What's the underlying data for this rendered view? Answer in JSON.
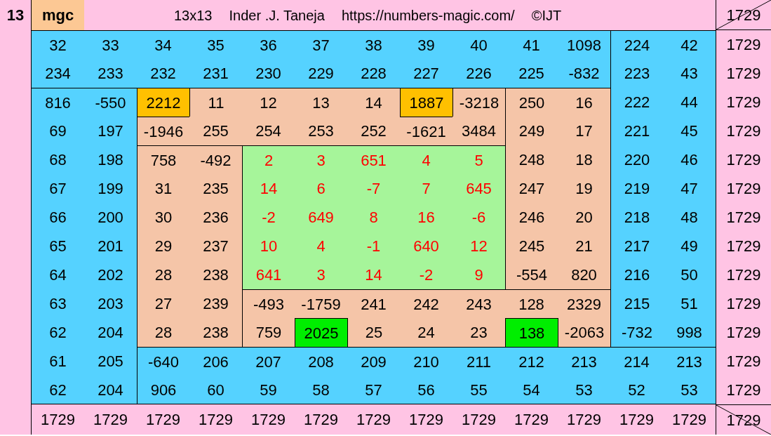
{
  "header": {
    "corner": "13",
    "tag": "mgc",
    "title_parts": [
      "13x13",
      "Inder .J. Taneja",
      "https://numbers-magic.com/",
      "©IJT"
    ],
    "total": "1729"
  },
  "rows": [
    {
      "total": "1729",
      "cells": [
        {
          "text": "32",
          "color": "#55d2ff",
          "red": false,
          "kind": "band_top"
        },
        {
          "text": "33",
          "color": "#55d2ff",
          "red": false,
          "kind": "band_top"
        },
        {
          "text": "34",
          "color": "#55d2ff",
          "red": false,
          "kind": "band_top"
        },
        {
          "text": "35",
          "color": "#55d2ff",
          "red": false,
          "kind": "band_top"
        },
        {
          "text": "36",
          "color": "#55d2ff",
          "red": false,
          "kind": "band_top"
        },
        {
          "text": "37",
          "color": "#55d2ff",
          "red": false,
          "kind": "band_top"
        },
        {
          "text": "38",
          "color": "#55d2ff",
          "red": false,
          "kind": "band_top"
        },
        {
          "text": "39",
          "color": "#55d2ff",
          "red": false,
          "kind": "band_top"
        },
        {
          "text": "40",
          "color": "#55d2ff",
          "red": false,
          "kind": "band_top"
        },
        {
          "text": "41",
          "color": "#55d2ff",
          "red": false,
          "kind": "band_top"
        },
        {
          "text": "1098",
          "color": "#55d2ff",
          "red": false,
          "kind": "band_top"
        },
        {
          "text": "224",
          "color": "#55d2ff",
          "red": false,
          "kind": "band_right"
        },
        {
          "text": "42",
          "color": "#55d2ff",
          "red": false,
          "kind": "band_right"
        }
      ]
    },
    {
      "total": "1729",
      "cells": [
        {
          "text": "234",
          "color": "#55d2ff",
          "red": false,
          "kind": "band_top"
        },
        {
          "text": "233",
          "color": "#55d2ff",
          "red": false,
          "kind": "band_top"
        },
        {
          "text": "232",
          "color": "#55d2ff",
          "red": false,
          "kind": "band_top"
        },
        {
          "text": "231",
          "color": "#55d2ff",
          "red": false,
          "kind": "band_top"
        },
        {
          "text": "230",
          "color": "#55d2ff",
          "red": false,
          "kind": "band_top"
        },
        {
          "text": "229",
          "color": "#55d2ff",
          "red": false,
          "kind": "band_top"
        },
        {
          "text": "228",
          "color": "#55d2ff",
          "red": false,
          "kind": "band_top"
        },
        {
          "text": "227",
          "color": "#55d2ff",
          "red": false,
          "kind": "band_top"
        },
        {
          "text": "226",
          "color": "#55d2ff",
          "red": false,
          "kind": "band_top"
        },
        {
          "text": "225",
          "color": "#55d2ff",
          "red": false,
          "kind": "band_top"
        },
        {
          "text": "-832",
          "color": "#55d2ff",
          "red": false,
          "kind": "band_top"
        },
        {
          "text": "223",
          "color": "#55d2ff",
          "red": false,
          "kind": "band_right"
        },
        {
          "text": "43",
          "color": "#55d2ff",
          "red": false,
          "kind": "band_right"
        }
      ]
    },
    {
      "total": "1729",
      "cells": [
        {
          "text": "816",
          "color": "#55d2ff",
          "red": false,
          "kind": "band_left"
        },
        {
          "text": "-550",
          "color": "#55d2ff",
          "red": false,
          "kind": "band_left"
        },
        {
          "text": "2212",
          "color": "#ffc000",
          "red": false,
          "kind": "mark"
        },
        {
          "text": "11",
          "color": "#f5c5a8",
          "red": false,
          "kind": "frame_top"
        },
        {
          "text": "12",
          "color": "#f5c5a8",
          "red": false,
          "kind": "frame_top"
        },
        {
          "text": "13",
          "color": "#f5c5a8",
          "red": false,
          "kind": "frame_top"
        },
        {
          "text": "14",
          "color": "#f5c5a8",
          "red": false,
          "kind": "frame_top"
        },
        {
          "text": "1887",
          "color": "#ffc000",
          "red": false,
          "kind": "mark"
        },
        {
          "text": "-3218",
          "color": "#f5c5a8",
          "red": false,
          "kind": "frame_top"
        },
        {
          "text": "250",
          "color": "#f5c5a8",
          "red": false,
          "kind": "frame_right"
        },
        {
          "text": "16",
          "color": "#f5c5a8",
          "red": false,
          "kind": "frame_right"
        },
        {
          "text": "222",
          "color": "#55d2ff",
          "red": false,
          "kind": "band_right"
        },
        {
          "text": "44",
          "color": "#55d2ff",
          "red": false,
          "kind": "band_right"
        }
      ]
    },
    {
      "total": "1729",
      "cells": [
        {
          "text": "69",
          "color": "#55d2ff",
          "red": false,
          "kind": "band_left"
        },
        {
          "text": "197",
          "color": "#55d2ff",
          "red": false,
          "kind": "band_left"
        },
        {
          "text": "-1946",
          "color": "#f5c5a8",
          "red": false,
          "kind": "frame_top"
        },
        {
          "text": "255",
          "color": "#f5c5a8",
          "red": false,
          "kind": "frame_top"
        },
        {
          "text": "254",
          "color": "#f5c5a8",
          "red": false,
          "kind": "frame_top"
        },
        {
          "text": "253",
          "color": "#f5c5a8",
          "red": false,
          "kind": "frame_top"
        },
        {
          "text": "252",
          "color": "#f5c5a8",
          "red": false,
          "kind": "frame_top"
        },
        {
          "text": "-1621",
          "color": "#f5c5a8",
          "red": false,
          "kind": "frame_top"
        },
        {
          "text": "3484",
          "color": "#f5c5a8",
          "red": false,
          "kind": "frame_top"
        },
        {
          "text": "249",
          "color": "#f5c5a8",
          "red": false,
          "kind": "frame_right"
        },
        {
          "text": "17",
          "color": "#f5c5a8",
          "red": false,
          "kind": "frame_right"
        },
        {
          "text": "221",
          "color": "#55d2ff",
          "red": false,
          "kind": "band_right"
        },
        {
          "text": "45",
          "color": "#55d2ff",
          "red": false,
          "kind": "band_right"
        }
      ]
    },
    {
      "total": "1729",
      "cells": [
        {
          "text": "68",
          "color": "#55d2ff",
          "red": false,
          "kind": "band_left"
        },
        {
          "text": "198",
          "color": "#55d2ff",
          "red": false,
          "kind": "band_left"
        },
        {
          "text": "758",
          "color": "#f5c5a8",
          "red": false,
          "kind": "frame_left"
        },
        {
          "text": "-492",
          "color": "#f5c5a8",
          "red": false,
          "kind": "frame_left"
        },
        {
          "text": "2",
          "color": "#a6f59a",
          "red": true,
          "kind": "core"
        },
        {
          "text": "3",
          "color": "#a6f59a",
          "red": true,
          "kind": "core"
        },
        {
          "text": "651",
          "color": "#a6f59a",
          "red": true,
          "kind": "core"
        },
        {
          "text": "4",
          "color": "#a6f59a",
          "red": true,
          "kind": "core"
        },
        {
          "text": "5",
          "color": "#a6f59a",
          "red": true,
          "kind": "core"
        },
        {
          "text": "248",
          "color": "#f5c5a8",
          "red": false,
          "kind": "frame_right"
        },
        {
          "text": "18",
          "color": "#f5c5a8",
          "red": false,
          "kind": "frame_right"
        },
        {
          "text": "220",
          "color": "#55d2ff",
          "red": false,
          "kind": "band_right"
        },
        {
          "text": "46",
          "color": "#55d2ff",
          "red": false,
          "kind": "band_right"
        }
      ]
    },
    {
      "total": "1729",
      "cells": [
        {
          "text": "67",
          "color": "#55d2ff",
          "red": false,
          "kind": "band_left"
        },
        {
          "text": "199",
          "color": "#55d2ff",
          "red": false,
          "kind": "band_left"
        },
        {
          "text": "31",
          "color": "#f5c5a8",
          "red": false,
          "kind": "frame_left"
        },
        {
          "text": "235",
          "color": "#f5c5a8",
          "red": false,
          "kind": "frame_left"
        },
        {
          "text": "14",
          "color": "#a6f59a",
          "red": true,
          "kind": "core"
        },
        {
          "text": "6",
          "color": "#a6f59a",
          "red": true,
          "kind": "core"
        },
        {
          "text": "-7",
          "color": "#a6f59a",
          "red": true,
          "kind": "core"
        },
        {
          "text": "7",
          "color": "#a6f59a",
          "red": true,
          "kind": "core"
        },
        {
          "text": "645",
          "color": "#a6f59a",
          "red": true,
          "kind": "core"
        },
        {
          "text": "247",
          "color": "#f5c5a8",
          "red": false,
          "kind": "frame_right"
        },
        {
          "text": "19",
          "color": "#f5c5a8",
          "red": false,
          "kind": "frame_right"
        },
        {
          "text": "219",
          "color": "#55d2ff",
          "red": false,
          "kind": "band_right"
        },
        {
          "text": "47",
          "color": "#55d2ff",
          "red": false,
          "kind": "band_right"
        }
      ]
    },
    {
      "total": "1729",
      "cells": [
        {
          "text": "66",
          "color": "#55d2ff",
          "red": false,
          "kind": "band_left"
        },
        {
          "text": "200",
          "color": "#55d2ff",
          "red": false,
          "kind": "band_left"
        },
        {
          "text": "30",
          "color": "#f5c5a8",
          "red": false,
          "kind": "frame_left"
        },
        {
          "text": "236",
          "color": "#f5c5a8",
          "red": false,
          "kind": "frame_left"
        },
        {
          "text": "-2",
          "color": "#a6f59a",
          "red": true,
          "kind": "core"
        },
        {
          "text": "649",
          "color": "#a6f59a",
          "red": true,
          "kind": "core"
        },
        {
          "text": "8",
          "color": "#a6f59a",
          "red": true,
          "kind": "core"
        },
        {
          "text": "16",
          "color": "#a6f59a",
          "red": true,
          "kind": "core"
        },
        {
          "text": "-6",
          "color": "#a6f59a",
          "red": true,
          "kind": "core"
        },
        {
          "text": "246",
          "color": "#f5c5a8",
          "red": false,
          "kind": "frame_right"
        },
        {
          "text": "20",
          "color": "#f5c5a8",
          "red": false,
          "kind": "frame_right"
        },
        {
          "text": "218",
          "color": "#55d2ff",
          "red": false,
          "kind": "band_right"
        },
        {
          "text": "48",
          "color": "#55d2ff",
          "red": false,
          "kind": "band_right"
        }
      ]
    },
    {
      "total": "1729",
      "cells": [
        {
          "text": "65",
          "color": "#55d2ff",
          "red": false,
          "kind": "band_left"
        },
        {
          "text": "201",
          "color": "#55d2ff",
          "red": false,
          "kind": "band_left"
        },
        {
          "text": "29",
          "color": "#f5c5a8",
          "red": false,
          "kind": "frame_left"
        },
        {
          "text": "237",
          "color": "#f5c5a8",
          "red": false,
          "kind": "frame_left"
        },
        {
          "text": "10",
          "color": "#a6f59a",
          "red": true,
          "kind": "core"
        },
        {
          "text": "4",
          "color": "#a6f59a",
          "red": true,
          "kind": "core"
        },
        {
          "text": "-1",
          "color": "#a6f59a",
          "red": true,
          "kind": "core"
        },
        {
          "text": "640",
          "color": "#a6f59a",
          "red": true,
          "kind": "core"
        },
        {
          "text": "12",
          "color": "#a6f59a",
          "red": true,
          "kind": "core"
        },
        {
          "text": "245",
          "color": "#f5c5a8",
          "red": false,
          "kind": "frame_right"
        },
        {
          "text": "21",
          "color": "#f5c5a8",
          "red": false,
          "kind": "frame_right"
        },
        {
          "text": "217",
          "color": "#55d2ff",
          "red": false,
          "kind": "band_right"
        },
        {
          "text": "49",
          "color": "#55d2ff",
          "red": false,
          "kind": "band_right"
        }
      ]
    },
    {
      "total": "1729",
      "cells": [
        {
          "text": "64",
          "color": "#55d2ff",
          "red": false,
          "kind": "band_left"
        },
        {
          "text": "202",
          "color": "#55d2ff",
          "red": false,
          "kind": "band_left"
        },
        {
          "text": "28",
          "color": "#f5c5a8",
          "red": false,
          "kind": "frame_left"
        },
        {
          "text": "238",
          "color": "#f5c5a8",
          "red": false,
          "kind": "frame_left"
        },
        {
          "text": "641",
          "color": "#a6f59a",
          "red": true,
          "kind": "core"
        },
        {
          "text": "3",
          "color": "#a6f59a",
          "red": true,
          "kind": "core"
        },
        {
          "text": "14",
          "color": "#a6f59a",
          "red": true,
          "kind": "core"
        },
        {
          "text": "-2",
          "color": "#a6f59a",
          "red": true,
          "kind": "core"
        },
        {
          "text": "9",
          "color": "#a6f59a",
          "red": true,
          "kind": "core"
        },
        {
          "text": "-554",
          "color": "#f5c5a8",
          "red": false,
          "kind": "frame_right"
        },
        {
          "text": "820",
          "color": "#f5c5a8",
          "red": false,
          "kind": "frame_right"
        },
        {
          "text": "216",
          "color": "#55d2ff",
          "red": false,
          "kind": "band_right"
        },
        {
          "text": "50",
          "color": "#55d2ff",
          "red": false,
          "kind": "band_right"
        }
      ]
    },
    {
      "total": "1729",
      "cells": [
        {
          "text": "63",
          "color": "#55d2ff",
          "red": false,
          "kind": "band_left"
        },
        {
          "text": "203",
          "color": "#55d2ff",
          "red": false,
          "kind": "band_left"
        },
        {
          "text": "27",
          "color": "#f5c5a8",
          "red": false,
          "kind": "frame_left"
        },
        {
          "text": "239",
          "color": "#f5c5a8",
          "red": false,
          "kind": "frame_left"
        },
        {
          "text": "-493",
          "color": "#f5c5a8",
          "red": false,
          "kind": "frame_bottom"
        },
        {
          "text": "-1759",
          "color": "#f5c5a8",
          "red": false,
          "kind": "frame_bottom"
        },
        {
          "text": "241",
          "color": "#f5c5a8",
          "red": false,
          "kind": "frame_bottom"
        },
        {
          "text": "242",
          "color": "#f5c5a8",
          "red": false,
          "kind": "frame_bottom"
        },
        {
          "text": "243",
          "color": "#f5c5a8",
          "red": false,
          "kind": "frame_bottom"
        },
        {
          "text": "128",
          "color": "#f5c5a8",
          "red": false,
          "kind": "frame_bottom"
        },
        {
          "text": "2329",
          "color": "#f5c5a8",
          "red": false,
          "kind": "frame_bottom"
        },
        {
          "text": "215",
          "color": "#55d2ff",
          "red": false,
          "kind": "band_right"
        },
        {
          "text": "51",
          "color": "#55d2ff",
          "red": false,
          "kind": "band_right"
        }
      ]
    },
    {
      "total": "1729",
      "cells": [
        {
          "text": "62",
          "color": "#55d2ff",
          "red": false,
          "kind": "band_left"
        },
        {
          "text": "204",
          "color": "#55d2ff",
          "red": false,
          "kind": "band_left"
        },
        {
          "text": "28",
          "color": "#f5c5a8",
          "red": false,
          "kind": "frame_left"
        },
        {
          "text": "238",
          "color": "#f5c5a8",
          "red": false,
          "kind": "frame_left"
        },
        {
          "text": "759",
          "color": "#f5c5a8",
          "red": false,
          "kind": "frame_bottom"
        },
        {
          "text": "2025",
          "color": "#00ee00",
          "red": false,
          "kind": "mark"
        },
        {
          "text": "25",
          "color": "#f5c5a8",
          "red": false,
          "kind": "frame_bottom"
        },
        {
          "text": "24",
          "color": "#f5c5a8",
          "red": false,
          "kind": "frame_bottom"
        },
        {
          "text": "23",
          "color": "#f5c5a8",
          "red": false,
          "kind": "frame_bottom"
        },
        {
          "text": "138",
          "color": "#00ee00",
          "red": false,
          "kind": "mark"
        },
        {
          "text": "-2063",
          "color": "#f5c5a8",
          "red": false,
          "kind": "frame_bottom"
        },
        {
          "text": "-732",
          "color": "#55d2ff",
          "red": false,
          "kind": "band_right"
        },
        {
          "text": "998",
          "color": "#55d2ff",
          "red": false,
          "kind": "band_right"
        }
      ]
    },
    {
      "total": "1729",
      "cells": [
        {
          "text": "61",
          "color": "#55d2ff",
          "red": false,
          "kind": "band_left"
        },
        {
          "text": "205",
          "color": "#55d2ff",
          "red": false,
          "kind": "band_left"
        },
        {
          "text": "-640",
          "color": "#55d2ff",
          "red": false,
          "kind": "band_bottom"
        },
        {
          "text": "206",
          "color": "#55d2ff",
          "red": false,
          "kind": "band_bottom"
        },
        {
          "text": "207",
          "color": "#55d2ff",
          "red": false,
          "kind": "band_bottom"
        },
        {
          "text": "208",
          "color": "#55d2ff",
          "red": false,
          "kind": "band_bottom"
        },
        {
          "text": "209",
          "color": "#55d2ff",
          "red": false,
          "kind": "band_bottom"
        },
        {
          "text": "210",
          "color": "#55d2ff",
          "red": false,
          "kind": "band_bottom"
        },
        {
          "text": "211",
          "color": "#55d2ff",
          "red": false,
          "kind": "band_bottom"
        },
        {
          "text": "212",
          "color": "#55d2ff",
          "red": false,
          "kind": "band_bottom"
        },
        {
          "text": "213",
          "color": "#55d2ff",
          "red": false,
          "kind": "band_bottom"
        },
        {
          "text": "214",
          "color": "#55d2ff",
          "red": false,
          "kind": "band_bottom"
        },
        {
          "text": "213",
          "color": "#55d2ff",
          "red": false,
          "kind": "band_bottom"
        }
      ]
    },
    {
      "total": "1729",
      "cells": [
        {
          "text": "62",
          "color": "#55d2ff",
          "red": false,
          "kind": "band_left"
        },
        {
          "text": "204",
          "color": "#55d2ff",
          "red": false,
          "kind": "band_left"
        },
        {
          "text": "906",
          "color": "#55d2ff",
          "red": false,
          "kind": "band_bottom"
        },
        {
          "text": "60",
          "color": "#55d2ff",
          "red": false,
          "kind": "band_bottom"
        },
        {
          "text": "59",
          "color": "#55d2ff",
          "red": false,
          "kind": "band_bottom"
        },
        {
          "text": "58",
          "color": "#55d2ff",
          "red": false,
          "kind": "band_bottom"
        },
        {
          "text": "57",
          "color": "#55d2ff",
          "red": false,
          "kind": "band_bottom"
        },
        {
          "text": "56",
          "color": "#55d2ff",
          "red": false,
          "kind": "band_bottom"
        },
        {
          "text": "55",
          "color": "#55d2ff",
          "red": false,
          "kind": "band_bottom"
        },
        {
          "text": "54",
          "color": "#55d2ff",
          "red": false,
          "kind": "band_bottom"
        },
        {
          "text": "53",
          "color": "#55d2ff",
          "red": false,
          "kind": "band_bottom"
        },
        {
          "text": "52",
          "color": "#55d2ff",
          "red": false,
          "kind": "band_bottom"
        },
        {
          "text": "53",
          "color": "#55d2ff",
          "red": false,
          "kind": "band_bottom"
        }
      ]
    }
  ],
  "column_totals": [
    "1729",
    "1729",
    "1729",
    "1729",
    "1729",
    "1729",
    "1729",
    "1729",
    "1729",
    "1729",
    "1729",
    "1729",
    "1729"
  ],
  "grand_total": "1729"
}
